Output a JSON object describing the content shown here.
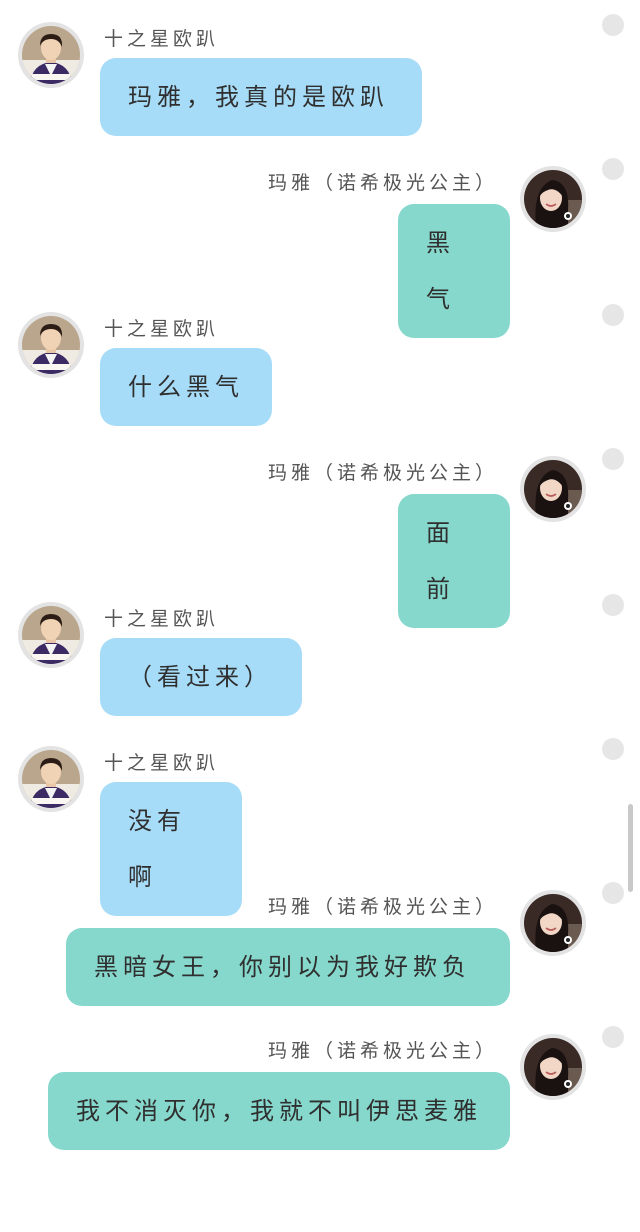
{
  "contacts": {
    "left_name": "十之星欧趴",
    "right_name": "玛雅（诺希极光公主）"
  },
  "messages": [
    {
      "side": "left",
      "text": "玛雅，我真的是欧趴"
    },
    {
      "side": "right",
      "text": "黑气"
    },
    {
      "side": "left",
      "text": "什么黑气"
    },
    {
      "side": "right",
      "text": "面前"
    },
    {
      "side": "left",
      "text": "（看过来）"
    },
    {
      "side": "left",
      "text": "没有啊"
    },
    {
      "side": "right",
      "text": "黑暗女王，你别以为我好欺负"
    },
    {
      "side": "right",
      "text": "我不消灭你，我就不叫伊思麦雅"
    }
  ],
  "colors": {
    "incoming_bubble": "#a7dcf8",
    "outgoing_bubble": "#86d8cc"
  },
  "icons": {
    "incoming_avatar": "boy-in-purple-uniform-avatar",
    "outgoing_avatar": "smiling-girl-avatar",
    "select_marker": "circle-select-icon"
  }
}
